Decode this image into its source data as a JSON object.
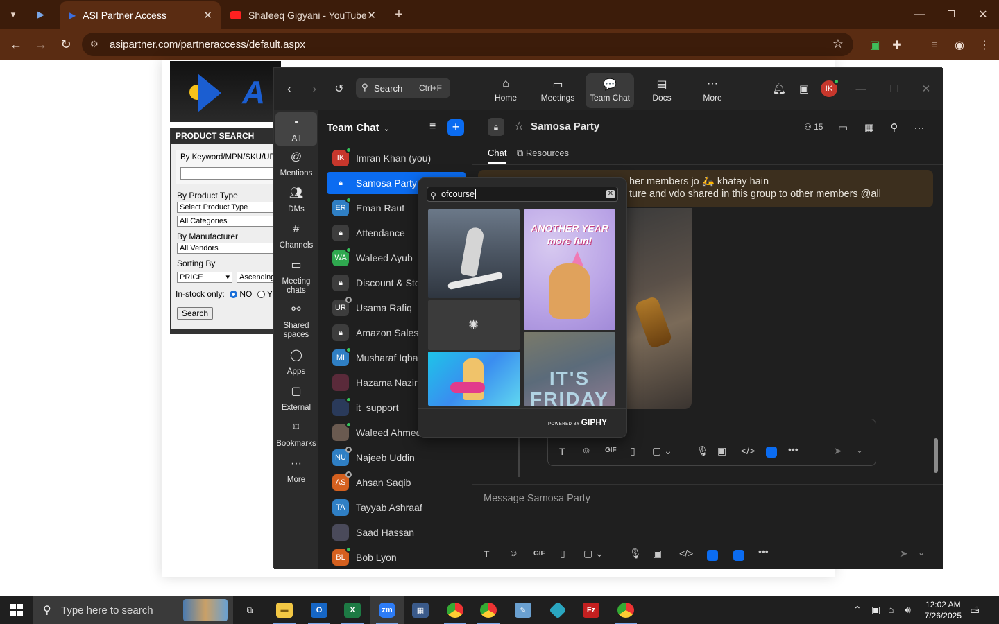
{
  "browser": {
    "tabs": [
      {
        "title": "ASI Partner Access",
        "active": true
      },
      {
        "title": "Shafeeq Gigyani - YouTube",
        "active": false
      }
    ],
    "url": "asipartner.com/partneraccess/default.aspx"
  },
  "webpage": {
    "logo_letter": "A",
    "product_search": {
      "title": "PRODUCT SEARCH",
      "keyword_label": "By Keyword/MPN/SKU/UPC",
      "keyword_value": "",
      "product_type_label": "By Product Type",
      "product_type_value": "Select Product Type",
      "category_value": "All Categories",
      "manufacturer_label": "By Manufacturer",
      "vendor_value": "All Vendors",
      "sorting_label": "Sorting By",
      "sort_field": "PRICE",
      "sort_order": "Ascending",
      "instock_label": "In-stock only:",
      "instock_no": "NO",
      "instock_yes": "Y",
      "search_button": "Search"
    }
  },
  "zoom": {
    "search": {
      "label": "Search",
      "shortcut": "Ctrl+F"
    },
    "nav": [
      {
        "label": "Home",
        "icon": "home-icon",
        "active": false
      },
      {
        "label": "Meetings",
        "icon": "video-icon",
        "active": false
      },
      {
        "label": "Team Chat",
        "icon": "chat-icon",
        "active": true
      },
      {
        "label": "Docs",
        "icon": "docs-icon",
        "active": false
      },
      {
        "label": "More",
        "icon": "more-icon",
        "active": false
      }
    ],
    "avatar_initials": "IK",
    "rail": [
      {
        "label": "All",
        "active": true
      },
      {
        "label": "Mentions",
        "active": false
      },
      {
        "label": "DMs",
        "active": false
      },
      {
        "label": "Channels",
        "active": false
      },
      {
        "label": "Meeting chats",
        "active": false
      },
      {
        "label": "Shared spaces",
        "active": false
      },
      {
        "label": "Apps",
        "active": false
      },
      {
        "label": "External",
        "active": false
      },
      {
        "label": "Bookmarks",
        "active": false
      },
      {
        "label": "More",
        "active": false
      }
    ],
    "list_title": "Team Chat",
    "contacts": [
      {
        "name": "Imran Khan (you)",
        "initials": "IK",
        "color": "#c7372c",
        "status": "#34c25a",
        "kind": "person"
      },
      {
        "name": "Samosa Party",
        "initials": "",
        "color": "#0b6cf1",
        "status": "",
        "kind": "lock",
        "active": true
      },
      {
        "name": "Eman Rauf",
        "initials": "ER",
        "color": "#2f7fc4",
        "status": "#34c25a",
        "kind": "person"
      },
      {
        "name": "Attendance",
        "initials": "",
        "color": "#3d3d3d",
        "status": "",
        "kind": "lock"
      },
      {
        "name": "Waleed Ayub",
        "initials": "WA",
        "color": "#2fa84f",
        "status": "#34c25a",
        "kind": "person"
      },
      {
        "name": "Discount & Stock",
        "initials": "",
        "color": "#3d3d3d",
        "status": "",
        "kind": "lock"
      },
      {
        "name": "Usama Rafiq",
        "initials": "UR",
        "color": "#3d3d3d",
        "status": "#1f1f1f",
        "kind": "person"
      },
      {
        "name": "Amazon Sales Team",
        "initials": "",
        "color": "#3d3d3d",
        "status": "",
        "kind": "lock"
      },
      {
        "name": "Musharaf Iqbal",
        "initials": "MI",
        "color": "#2f7fc4",
        "status": "#34c25a",
        "kind": "person"
      },
      {
        "name": "Hazama Nazir",
        "initials": "",
        "color": "#5a2a3a",
        "status": "",
        "kind": "photo"
      },
      {
        "name": "it_support",
        "initials": "",
        "color": "#2a3a5a",
        "status": "#34c25a",
        "kind": "photo"
      },
      {
        "name": "Waleed Ahmed",
        "initials": "",
        "color": "#6a5a50",
        "status": "#34c25a",
        "kind": "photo"
      },
      {
        "name": "Najeeb Uddin",
        "initials": "NU",
        "color": "#2f7fc4",
        "status": "#1f1f1f",
        "kind": "person"
      },
      {
        "name": "Ahsan Saqib",
        "initials": "AS",
        "color": "#d4601f",
        "status": "#1f1f1f",
        "kind": "person"
      },
      {
        "name": "Tayyab Ashraaf",
        "initials": "TA",
        "color": "#2f7fc4",
        "status": "",
        "kind": "person"
      },
      {
        "name": "Saad Hassan",
        "initials": "",
        "color": "#4a4a5a",
        "status": "",
        "kind": "photo"
      },
      {
        "name": "Bob Lyon",
        "initials": "BL",
        "color": "#d4601f",
        "status": "#34c25a",
        "kind": "person"
      }
    ],
    "chat": {
      "name": "Samosa Party",
      "member_count": "15",
      "tabs": [
        "Chat",
        "Resources"
      ],
      "pinned_line1": "her members jo 🛵 khatay hain",
      "pinned_line2": "ture and vdo shared in this group to other members @all",
      "compose_placeholder": "Message Samosa Party"
    },
    "gif_picker": {
      "query": "ofcourse",
      "gif_text_1": "ANOTHER YEAR more fun!",
      "gif_text_2": "IT'S FRIDAY",
      "powered_by": "POWERED BY",
      "brand": "GIPHY"
    }
  },
  "taskbar": {
    "search_placeholder": "Type here to search",
    "time": "12:02 AM",
    "date": "7/26/2025",
    "notification_count": "1"
  }
}
